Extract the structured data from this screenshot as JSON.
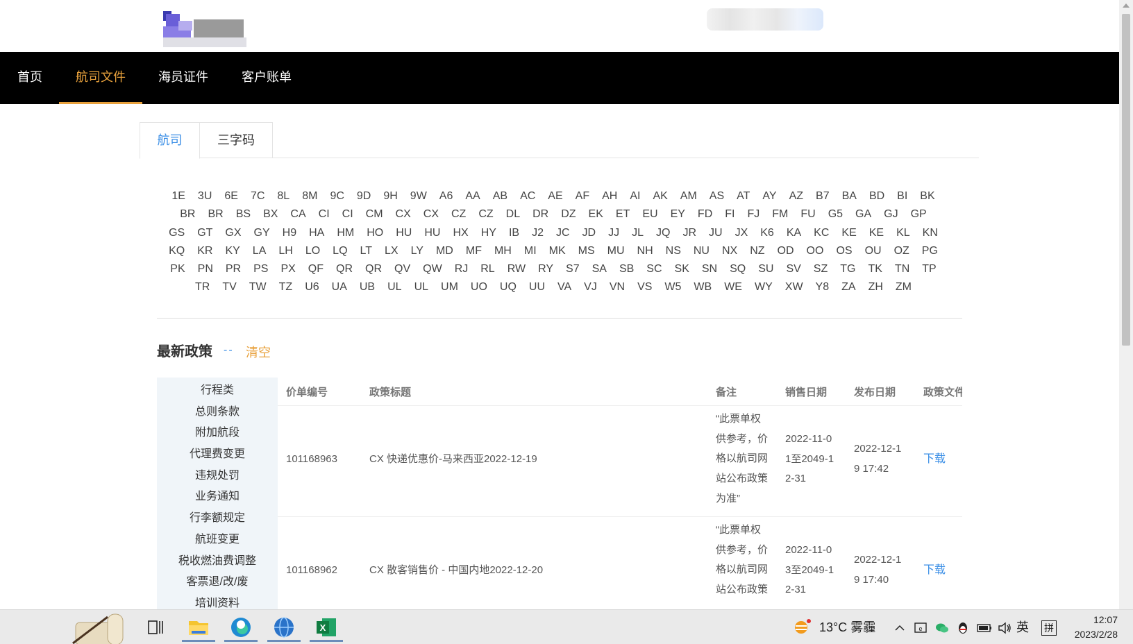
{
  "nav": {
    "items": [
      {
        "label": "首页"
      },
      {
        "label": "航司文件"
      },
      {
        "label": "海员证件"
      },
      {
        "label": "客户账单"
      }
    ],
    "active_index": 1
  },
  "tabs": [
    {
      "label": "航司"
    },
    {
      "label": "三字码"
    }
  ],
  "airline_codes": [
    [
      "1E",
      "3U",
      "6E",
      "7C",
      "8L",
      "8M",
      "9C",
      "9D",
      "9H",
      "9W",
      "A6",
      "AA",
      "AB",
      "AC",
      "AE",
      "AF",
      "AH",
      "AI",
      "AK",
      "AM",
      "AS",
      "AT",
      "AY",
      "AZ",
      "B7",
      "BA",
      "BD",
      "BI",
      "BK"
    ],
    [
      "BR",
      "BR",
      "BS",
      "BX",
      "CA",
      "CI",
      "CI",
      "CM",
      "CX",
      "CX",
      "CZ",
      "CZ",
      "DL",
      "DR",
      "DZ",
      "EK",
      "ET",
      "EU",
      "EY",
      "FD",
      "FI",
      "FJ",
      "FM",
      "FU",
      "G5",
      "GA",
      "GJ",
      "GP"
    ],
    [
      "GS",
      "GT",
      "GX",
      "GY",
      "H9",
      "HA",
      "HM",
      "HO",
      "HU",
      "HU",
      "HX",
      "HY",
      "IB",
      "J2",
      "JC",
      "JD",
      "JJ",
      "JL",
      "JQ",
      "JR",
      "JU",
      "JX",
      "K6",
      "KA",
      "KC",
      "KE",
      "KE",
      "KL",
      "KN"
    ],
    [
      "KQ",
      "KR",
      "KY",
      "LA",
      "LH",
      "LO",
      "LQ",
      "LT",
      "LX",
      "LY",
      "MD",
      "MF",
      "MH",
      "MI",
      "MK",
      "MS",
      "MU",
      "NH",
      "NS",
      "NU",
      "NX",
      "NZ",
      "OD",
      "OO",
      "OS",
      "OU",
      "OZ",
      "PG"
    ],
    [
      "PK",
      "PN",
      "PR",
      "PS",
      "PX",
      "QF",
      "QR",
      "QR",
      "QV",
      "QW",
      "RJ",
      "RL",
      "RW",
      "RY",
      "S7",
      "SA",
      "SB",
      "SC",
      "SK",
      "SN",
      "SQ",
      "SU",
      "SV",
      "SZ",
      "TG",
      "TK",
      "TN",
      "TP"
    ],
    [
      "TR",
      "TV",
      "TW",
      "TZ",
      "U6",
      "UA",
      "UB",
      "UL",
      "UL",
      "UM",
      "UO",
      "UQ",
      "UU",
      "VA",
      "VJ",
      "VN",
      "VS",
      "W5",
      "WB",
      "WE",
      "WY",
      "XW",
      "Y8",
      "ZA",
      "ZH",
      "ZM"
    ]
  ],
  "policy": {
    "title": "最新政策",
    "dashes": "--",
    "clear_label": "清空"
  },
  "categories": [
    "行程类",
    "总则条款",
    "附加航段",
    "代理费变更",
    "违规处罚",
    "业务通知",
    "行李额规定",
    "航班变更",
    "税收燃油费调整",
    "客票退/改/废",
    "培训资料"
  ],
  "table": {
    "headers": {
      "id": "价单编号",
      "title": "政策标题",
      "note": "备注",
      "sale_date": "销售日期",
      "publish_date": "发布日期",
      "file": "政策文件"
    },
    "rows": [
      {
        "id": "101168963",
        "title": "CX 快递优惠价-马来西亚2022-12-19",
        "note": [
          "“此票单权",
          "供参考，价",
          "格以航司网",
          "站公布政策",
          "为准”"
        ],
        "sale_date": [
          "2022-11-0",
          "1至2049-1",
          "2-31"
        ],
        "publish_date": [
          "2022-12-1",
          "9 17:42"
        ],
        "file": "下载"
      },
      {
        "id": "101168962",
        "title": "CX 散客销售价 - 中国内地2022-12-20",
        "note": [
          "“此票单权",
          "供参考，价",
          "格以航司网",
          "站公布政策"
        ],
        "sale_date": [
          "2022-11-0",
          "3至2049-1",
          "2-31"
        ],
        "publish_date": [
          "2022-12-1",
          "9 17:40"
        ],
        "file": "下载"
      }
    ]
  },
  "taskbar": {
    "weather": "13°C 雾霾",
    "ime_lang": "英",
    "ime_mode": "拼",
    "time": "12:07",
    "date": "2023/2/28"
  }
}
